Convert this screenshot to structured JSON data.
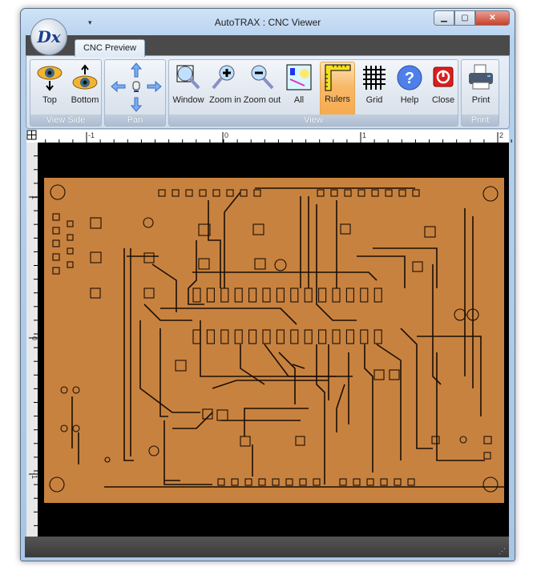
{
  "window": {
    "title": "AutoTRAX : CNC Viewer",
    "logo_text": "Dx",
    "qat_icon": "dropdown-arrow-icon"
  },
  "tabs": [
    {
      "label": "CNC Preview",
      "active": true
    }
  ],
  "ribbon": {
    "groups": [
      {
        "label": "View Side",
        "buttons": [
          {
            "label": "Top",
            "icon": "eye-down-icon"
          },
          {
            "label": "Bottom",
            "icon": "eye-up-icon"
          }
        ]
      },
      {
        "label": "Pan",
        "buttons": [
          {
            "icon": "arrow-up-icon"
          },
          {
            "icon": "arrow-left-icon"
          },
          {
            "icon": "hand-icon"
          },
          {
            "icon": "arrow-right-icon"
          },
          {
            "icon": "arrow-down-icon"
          }
        ]
      },
      {
        "label": "View",
        "buttons": [
          {
            "label": "Window",
            "icon": "magnifier-window-icon"
          },
          {
            "label": "Zoom in",
            "icon": "zoom-in-icon"
          },
          {
            "label": "Zoom out",
            "icon": "zoom-out-icon"
          },
          {
            "label": "All",
            "icon": "view-all-icon"
          },
          {
            "label": "Rulers",
            "icon": "ruler-icon",
            "active": true
          },
          {
            "label": "Grid",
            "icon": "grid-icon"
          },
          {
            "label": "Help",
            "icon": "help-icon"
          },
          {
            "label": "Close",
            "icon": "power-icon"
          }
        ]
      },
      {
        "label": "Print",
        "buttons": [
          {
            "label": "Print",
            "icon": "printer-icon"
          }
        ]
      }
    ]
  },
  "rulers": {
    "top_labels": [
      "-1",
      "0",
      "1",
      "2"
    ],
    "left_labels": [
      "1",
      "0",
      "-1"
    ]
  },
  "colors": {
    "board": "#c8823f",
    "trace_dark": "#1a0e04",
    "canvas": "#000000",
    "active_button": "#f8b868"
  }
}
